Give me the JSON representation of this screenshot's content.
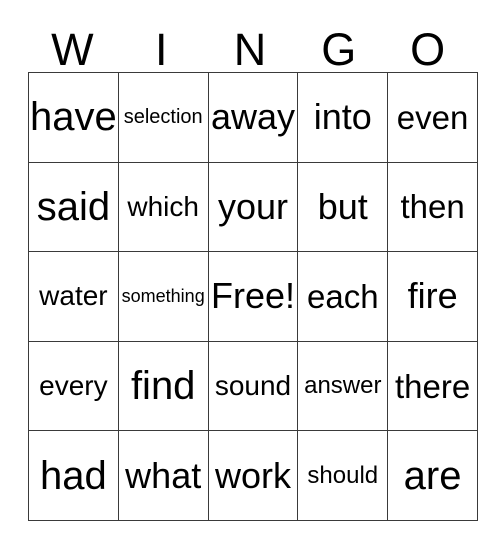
{
  "card": {
    "title_letters": [
      "W",
      "I",
      "N",
      "G",
      "O"
    ],
    "free_space": "Free!",
    "grid": [
      [
        {
          "word": "have",
          "size": "fs-xl"
        },
        {
          "word": "selection",
          "size": "fs-xxs"
        },
        {
          "word": "away",
          "size": "fs-lg"
        },
        {
          "word": "into",
          "size": "fs-lg"
        },
        {
          "word": "even",
          "size": "fs-md"
        }
      ],
      [
        {
          "word": "said",
          "size": "fs-xl"
        },
        {
          "word": "which",
          "size": "fs-sm"
        },
        {
          "word": "your",
          "size": "fs-lg"
        },
        {
          "word": "but",
          "size": "fs-lg"
        },
        {
          "word": "then",
          "size": "fs-md"
        }
      ],
      [
        {
          "word": "water",
          "size": "fs-sm"
        },
        {
          "word": "something",
          "size": "fs-tiny"
        },
        {
          "word": "Free!",
          "size": "fs-lg"
        },
        {
          "word": "each",
          "size": "fs-md"
        },
        {
          "word": "fire",
          "size": "fs-lg"
        }
      ],
      [
        {
          "word": "every",
          "size": "fs-sm"
        },
        {
          "word": "find",
          "size": "fs-xl"
        },
        {
          "word": "sound",
          "size": "fs-sm"
        },
        {
          "word": "answer",
          "size": "fs-xs"
        },
        {
          "word": "there",
          "size": "fs-md"
        }
      ],
      [
        {
          "word": "had",
          "size": "fs-xl"
        },
        {
          "word": "what",
          "size": "fs-lg"
        },
        {
          "word": "work",
          "size": "fs-lg"
        },
        {
          "word": "should",
          "size": "fs-xs"
        },
        {
          "word": "are",
          "size": "fs-xl"
        }
      ]
    ]
  },
  "style": {
    "border_color": "#3a3a3a",
    "text_color": "#000000",
    "background": "#ffffff"
  }
}
